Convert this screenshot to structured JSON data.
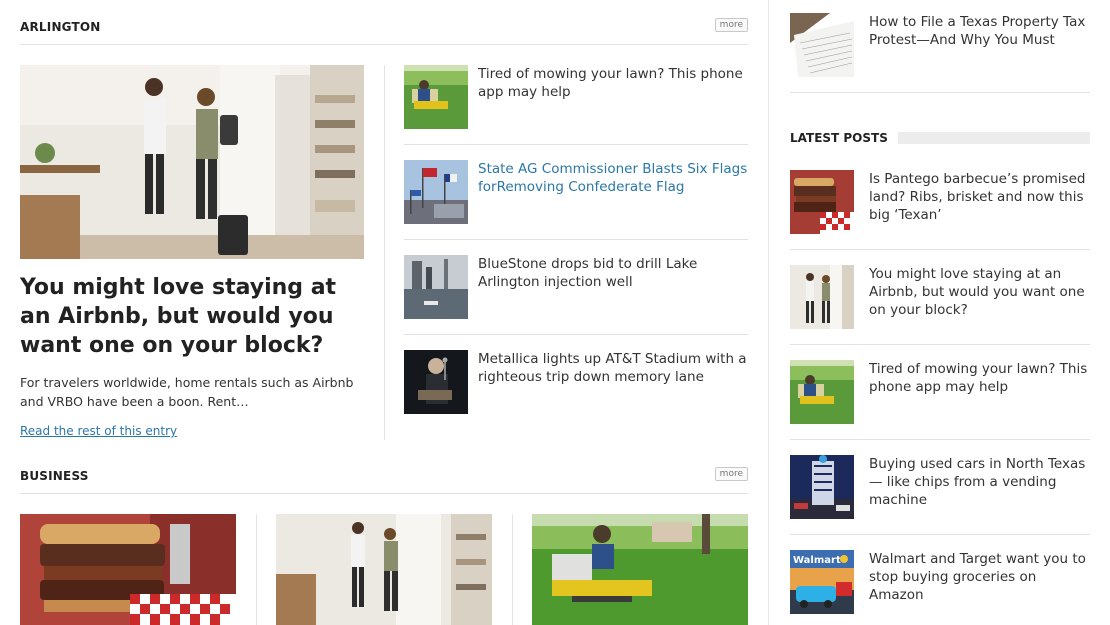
{
  "sections": {
    "arlington": {
      "title": "ARLINGTON",
      "more_label": "more"
    },
    "business": {
      "title": "BUSINESS",
      "more_label": "more"
    }
  },
  "featured": {
    "title": "You might love staying at an Airbnb, but would you want one on your block?",
    "excerpt": "For travelers worldwide, home rentals such as Airbnb and VRBO have been a boon. Rent…",
    "read_more": "Read the rest of this entry"
  },
  "arlington_list": [
    {
      "title": "Tired of mowing your lawn? This phone app may help",
      "icon": "lawn-mower-thumb"
    },
    {
      "title": "State AG Commissioner Blasts Six Flags forRemoving Confederate Flag",
      "icon": "flags-thumb"
    },
    {
      "title": "BlueStone drops bid to drill Lake Arlington injection well",
      "icon": "lake-thumb"
    },
    {
      "title": "Metallica lights up AT&T Stadium with a righteous trip down memory lane",
      "icon": "concert-thumb"
    }
  ],
  "sidebar": {
    "top_item": {
      "title": "How to File a Texas Property Tax Protest—And Why You Must",
      "icon": "tax-form-thumb"
    },
    "latest_posts_label": "LATEST POSTS",
    "latest_posts": [
      {
        "title": "Is Pantego barbecue’s promised land? Ribs, brisket and now this big ‘Texan’",
        "icon": "burger-thumb"
      },
      {
        "title": "You might love staying at an Airbnb, but would you want one on your block?",
        "icon": "airbnb-thumb"
      },
      {
        "title": "Tired of mowing your lawn? This phone app may help",
        "icon": "lawn-mower-thumb"
      },
      {
        "title": "Buying used cars in North Texas — like chips from a vending machine",
        "icon": "car-vending-thumb"
      },
      {
        "title": "Walmart and Target want you to stop buying groceries on Amazon",
        "icon": "walmart-thumb",
        "sign_text": "Walmart"
      }
    ]
  },
  "colors": {
    "link": "#2a77a8",
    "text": "#333333",
    "rule": "#e2e2e2"
  }
}
